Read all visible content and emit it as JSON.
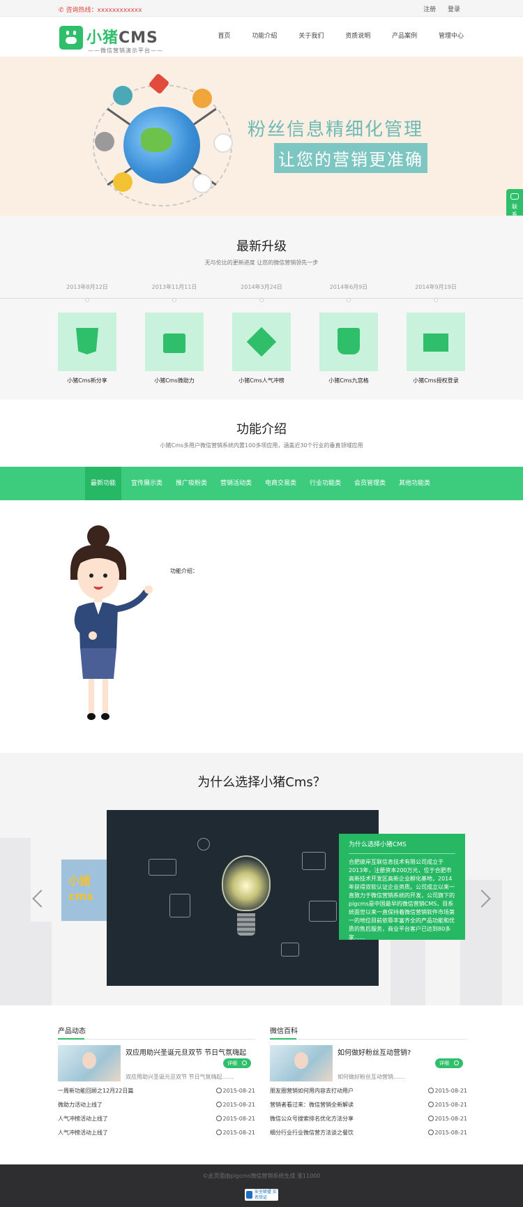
{
  "topbar": {
    "hotline": "咨询热线：xxxxxxxxxxxx",
    "register": "注册",
    "login": "登录"
  },
  "logo": {
    "title": "小猪",
    "title2": "CMS",
    "subtitle": "——微信营销演示平台——"
  },
  "nav": [
    "首页",
    "功能介绍",
    "关于我们",
    "资质说明",
    "产品案例",
    "管理中心"
  ],
  "banner": {
    "line1": "粉丝信息精细化管理",
    "line2": "让您的营销更准确"
  },
  "side_tab": "联系客服",
  "upgrade": {
    "title": "最新升级",
    "subtitle": "无与伦比的更新进度 让您的微信营销领先一步",
    "items": [
      {
        "date": "2013年8月12日",
        "label": "小猪Cms新分享",
        "icon": "html5-icon"
      },
      {
        "date": "2013年11月11日",
        "label": "小猪Cms微助力",
        "icon": "ballot-box-icon"
      },
      {
        "date": "2014年3月24日",
        "label": "小猪Cms人气冲榜",
        "icon": "double-check-icon"
      },
      {
        "date": "2014年6月9日",
        "label": "小猪Cms九宫格",
        "icon": "wechat-bag-icon"
      },
      {
        "date": "2014年9月19日",
        "label": "小猪Cms授权登录",
        "icon": "cash-register-icon"
      }
    ]
  },
  "func": {
    "title": "功能介绍",
    "subtitle": "小猪Cms多用户微信营销系统内置100多项应用，涵盖近30个行业的垂直领域应用",
    "tabs": [
      "最新功能",
      "宣传展示类",
      "推广吸粉类",
      "营销活动类",
      "电商交易类",
      "行业功能类",
      "会员管理类",
      "其他功能类"
    ],
    "active_tab": 0,
    "label": "功能介绍："
  },
  "why": {
    "title": "为什么选择小猪Cms？",
    "box_title": "为什么选择小猪CMS",
    "box_text": "合肥彼岸互联信息技术有限公司成立于2013年，注册资本200万元，位于合肥市高新技术开发区高新企业孵化基地，2014年获得双软认证企业资质。公司成立以来一直致力于微信营销系统的开发，公司旗下的pigcms是中国最早的微信营销CMS，目系统面世以来一直保持着微信营销软件市场第一的地位目前依靠丰富齐全的产品功能和优质的售后服务，商业平台客户已达到80多家……",
    "prev_slide_text": "小猪\ncms"
  },
  "news": {
    "left": {
      "title": "产品动态",
      "feature_title": "双应用助兴圣诞元旦双节 节日气氛嗨起",
      "feature_desc": "双应用助兴圣诞元旦双节 节日气氛嗨起……",
      "more": "详细",
      "rows": [
        {
          "title": "一周新功能回顾之12月22日篇",
          "date": "2015-08-21"
        },
        {
          "title": "微助力活动上线了",
          "date": "2015-08-21"
        },
        {
          "title": "人气冲榜活动上线了",
          "date": "2015-08-21"
        },
        {
          "title": "人气冲榜活动上线了",
          "date": "2015-08-21"
        }
      ]
    },
    "right": {
      "title": "微信百科",
      "feature_title": "如何做好粉丝互动营销?",
      "feature_desc": "如何做好粉丝互动营销……",
      "more": "详细",
      "rows": [
        {
          "title": "朋友圈营销如何用内容去打动用户",
          "date": "2015-08-21"
        },
        {
          "title": "营销者看过来：微信营销全新解读",
          "date": "2015-08-21"
        },
        {
          "title": "微信公众号搜索排名优化方法分享",
          "date": "2015-08-21"
        },
        {
          "title": "细分行业行业微信营方法谈之餐饮",
          "date": "2015-08-21"
        }
      ]
    }
  },
  "footer": {
    "copyright": "©此页面由pigcms微信营销系统生成 淮11000",
    "badge": "安全联盟 实名验证"
  },
  "colors": {
    "brand": "#2fbf6a",
    "tab_bar": "#3dcc7e",
    "banner_bg": "#fbefe4",
    "hotline": "#e0463c"
  }
}
